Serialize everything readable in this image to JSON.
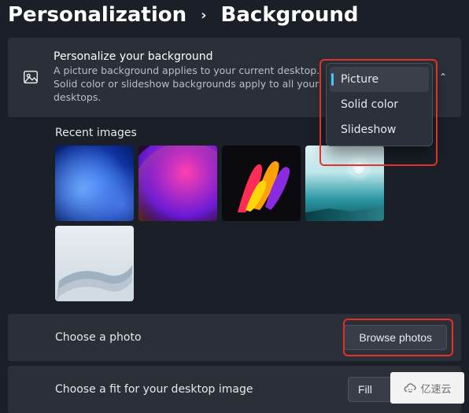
{
  "breadcrumb": {
    "parent": "Personalization",
    "separator": "›",
    "current": "Background"
  },
  "header": {
    "title": "Personalize your background",
    "description": "A picture background applies to your current desktop. Solid color or slideshow backgrounds apply to all your desktops."
  },
  "background_type_dropdown": {
    "options": [
      {
        "label": "Picture",
        "selected": true
      },
      {
        "label": "Solid color",
        "selected": false
      },
      {
        "label": "Slideshow",
        "selected": false
      }
    ]
  },
  "recent_images": {
    "title": "Recent images",
    "count": 5
  },
  "choose_photo": {
    "label": "Choose a photo",
    "button": "Browse photos"
  },
  "choose_fit": {
    "label": "Choose a fit for your desktop image",
    "value": "Fill"
  },
  "watermark": {
    "text": "亿速云"
  },
  "highlights": {
    "dropdown_highlight_color": "#e1322a",
    "browse_highlight_color": "#e1322a"
  }
}
